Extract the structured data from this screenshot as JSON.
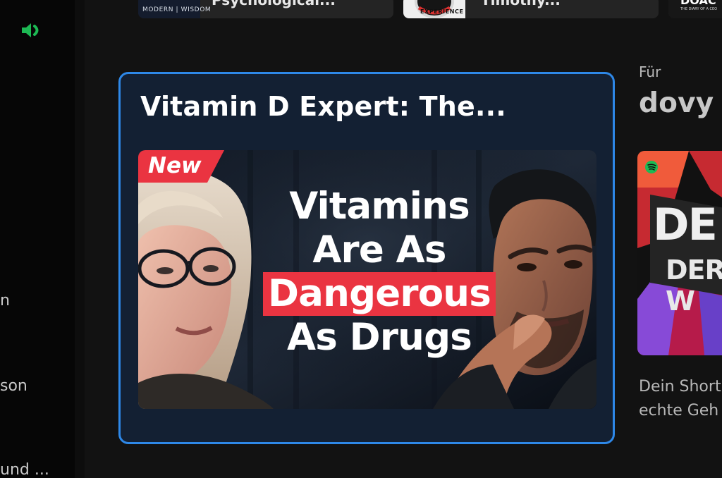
{
  "sidebar": {
    "items": [
      {
        "label": "n"
      },
      {
        "label": "son"
      },
      {
        "label": "und ..."
      }
    ]
  },
  "top_row": [
    {
      "title": "Psychological...",
      "logo_text": "MODERN | WISDOM"
    },
    {
      "title": "Timothy...",
      "logo_text": "EXPERIENCE"
    },
    {
      "title": "",
      "logo_text": "DOAC",
      "logo_sub": "THE DIARY OF A CEO"
    }
  ],
  "focused_card": {
    "title": "Vitamin D Expert: The...",
    "thumbnail": {
      "badge": "New",
      "lines": [
        "Vitamins",
        "Are As",
        "Dangerous",
        "As Drugs"
      ]
    }
  },
  "for_you": {
    "label": "Für",
    "user": "dovy"
  },
  "right_card": {
    "lines": [
      "DE",
      "DER W"
    ],
    "description": [
      "Dein Short",
      "echte Geh"
    ]
  },
  "colors": {
    "focus_border": "#2e88e8",
    "focus_background": "#132033",
    "badge_red": "#ea3441",
    "spotify_green": "#1db954"
  },
  "icons": {
    "speaker": "speaker-icon",
    "spotify": "spotify-icon"
  }
}
